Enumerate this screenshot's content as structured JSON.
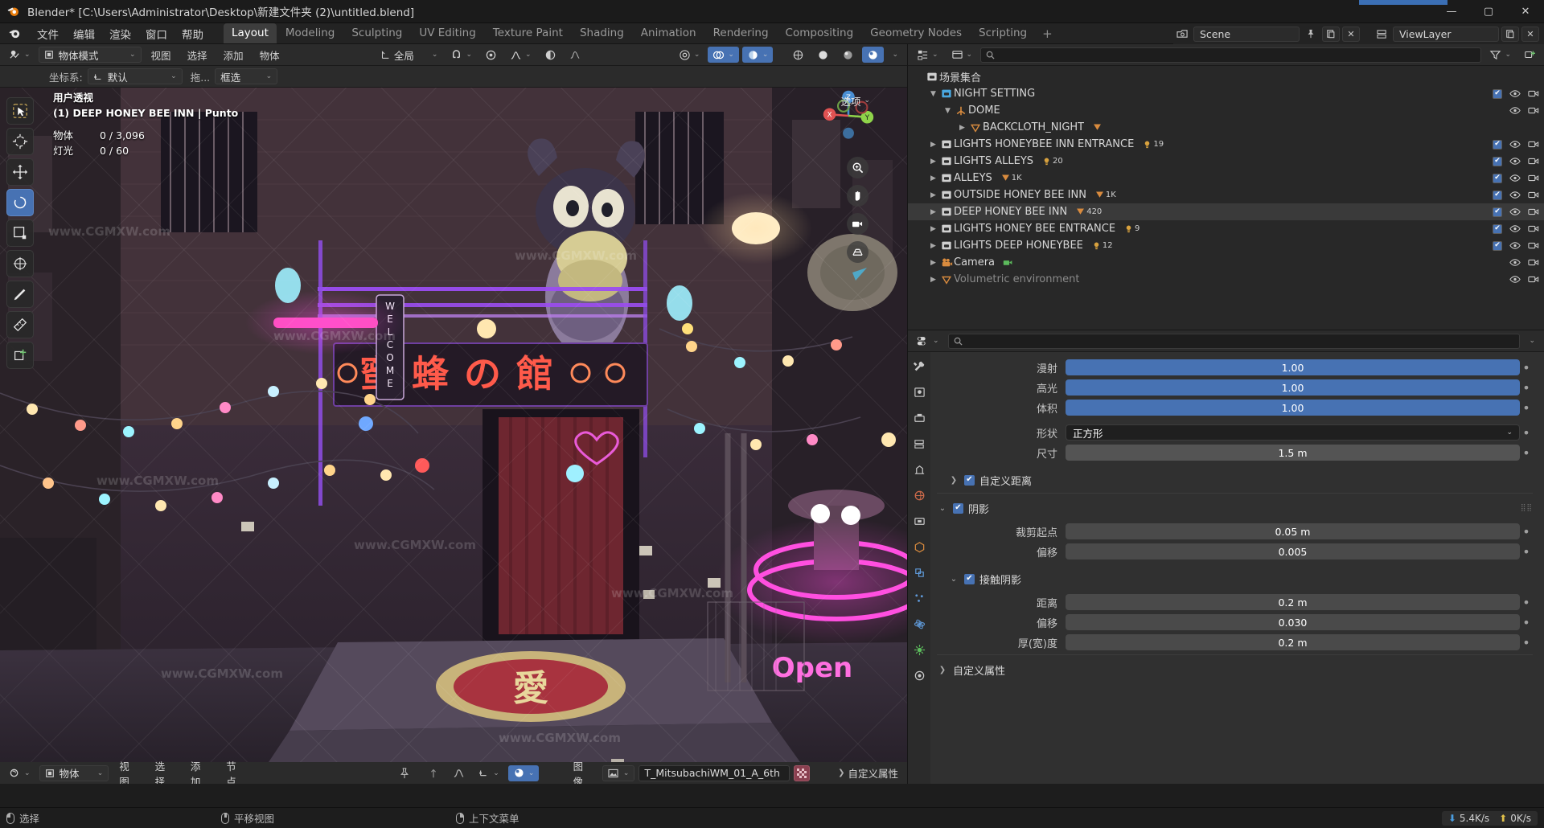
{
  "titlebar": {
    "title": "Blender* [C:\\Users\\Administrator\\Desktop\\新建文件夹 (2)\\untitled.blend]",
    "minimize": "—",
    "maximize": "▢",
    "close": "✕"
  },
  "menubar": {
    "items": [
      "文件",
      "编辑",
      "渲染",
      "窗口",
      "帮助"
    ],
    "workspaces": [
      {
        "label": "Layout",
        "active": true
      },
      {
        "label": "Modeling",
        "active": false
      },
      {
        "label": "Sculpting",
        "active": false
      },
      {
        "label": "UV Editing",
        "active": false
      },
      {
        "label": "Texture Paint",
        "active": false
      },
      {
        "label": "Shading",
        "active": false
      },
      {
        "label": "Animation",
        "active": false
      },
      {
        "label": "Rendering",
        "active": false
      },
      {
        "label": "Compositing",
        "active": false
      },
      {
        "label": "Geometry Nodes",
        "active": false
      },
      {
        "label": "Scripting",
        "active": false
      }
    ],
    "add_workspace": "+",
    "scene_name": "Scene",
    "viewlayer_name": "ViewLayer"
  },
  "viewport": {
    "mode": "物体模式",
    "menus": [
      "视图",
      "选择",
      "添加",
      "物体"
    ],
    "transform_orientation": "全局",
    "options_label": "选项",
    "row2": {
      "orient_label": "坐标系:",
      "orient_value": "默认",
      "drag_label": "拖...",
      "drag_value": "框选"
    },
    "overlay": {
      "perspective": "用户透视",
      "active_object": "(1) DEEP HONEY BEE INN | Punto",
      "stats": [
        {
          "key": "物体",
          "value": "0 / 3,096"
        },
        {
          "key": "灯光",
          "value": "0 / 60"
        }
      ]
    },
    "gizmo_axes": [
      "X",
      "Y",
      "Z"
    ],
    "footer": {
      "editor_mode": "物体",
      "menus": [
        "视图",
        "选择",
        "添加",
        "节点"
      ],
      "image_label": "图像",
      "image_name": "T_MitsubachiWM_01_A_6th",
      "custom_props": "自定义属性"
    }
  },
  "outliner": {
    "search_placeholder": "",
    "filter_icon": "funnel-icon",
    "rows": [
      {
        "name": "场景集合",
        "indent": 0,
        "tri": "",
        "icon": "collection-icon",
        "badge": null,
        "cnt": null,
        "check": false,
        "eye": false,
        "cam": false,
        "selected": false,
        "dim": false
      },
      {
        "name": "NIGHT SETTING",
        "indent": 1,
        "tri": "▼",
        "icon": "collection-blue-icon",
        "badge": null,
        "cnt": null,
        "check": true,
        "eye": true,
        "cam": true,
        "selected": false,
        "dim": false
      },
      {
        "name": "DOME",
        "indent": 2,
        "tri": "▼",
        "icon": "empty-axes-icon",
        "badge": null,
        "cnt": null,
        "check": false,
        "eye": true,
        "cam": true,
        "selected": false,
        "dim": false
      },
      {
        "name": "BACKCLOTH_NIGHT",
        "indent": 3,
        "tri": "▶",
        "icon": "mesh-cone-icon",
        "badge": "mesh-data-icon",
        "cnt": null,
        "check": false,
        "eye": false,
        "cam": false,
        "selected": false,
        "dim": false
      },
      {
        "name": "LIGHTS HONEYBEE INN ENTRANCE",
        "indent": 1,
        "tri": "▶",
        "icon": "collection-icon",
        "badge": "light-icon",
        "cnt": "19",
        "check": true,
        "eye": true,
        "cam": true,
        "selected": false,
        "dim": false
      },
      {
        "name": "LIGHTS ALLEYS",
        "indent": 1,
        "tri": "▶",
        "icon": "collection-icon",
        "badge": "light-icon",
        "cnt": "20",
        "check": true,
        "eye": true,
        "cam": true,
        "selected": false,
        "dim": false
      },
      {
        "name": "ALLEYS",
        "indent": 1,
        "tri": "▶",
        "icon": "collection-icon",
        "badge": "mesh-data-icon",
        "cnt": "1K",
        "check": true,
        "eye": true,
        "cam": true,
        "selected": false,
        "dim": false
      },
      {
        "name": "OUTSIDE HONEY BEE INN",
        "indent": 1,
        "tri": "▶",
        "icon": "collection-icon",
        "badge": "mesh-data-icon",
        "cnt": "1K",
        "check": true,
        "eye": true,
        "cam": true,
        "selected": false,
        "dim": false
      },
      {
        "name": "DEEP HONEY BEE INN",
        "indent": 1,
        "tri": "▶",
        "icon": "collection-icon",
        "badge": "mesh-data-icon",
        "cnt": "420",
        "check": true,
        "eye": true,
        "cam": true,
        "selected": true,
        "dim": false
      },
      {
        "name": "LIGHTS HONEY BEE ENTRANCE",
        "indent": 1,
        "tri": "▶",
        "icon": "collection-icon",
        "badge": "light-icon",
        "cnt": "9",
        "check": true,
        "eye": true,
        "cam": true,
        "selected": false,
        "dim": false
      },
      {
        "name": "LIGHTS DEEP HONEYBEE",
        "indent": 1,
        "tri": "▶",
        "icon": "collection-icon",
        "badge": "light-icon",
        "cnt": "12",
        "check": true,
        "eye": true,
        "cam": true,
        "selected": false,
        "dim": false
      },
      {
        "name": "Camera",
        "indent": 1,
        "tri": "▶",
        "icon": "camera-icon",
        "badge": "camera-data-icon",
        "cnt": null,
        "check": false,
        "eye": true,
        "cam": true,
        "selected": false,
        "dim": false
      },
      {
        "name": "Volumetric environment",
        "indent": 1,
        "tri": "▶",
        "icon": "mesh-cone-icon",
        "badge": null,
        "cnt": null,
        "check": false,
        "eye": true,
        "cam": true,
        "selected": false,
        "dim": true
      }
    ]
  },
  "properties": {
    "search_placeholder": "",
    "tabs": [
      "tool-icon",
      "render-icon",
      "output-icon",
      "viewlayer-icon",
      "scene-icon",
      "world-icon",
      "collection-icon",
      "object-icon",
      "modifier-icon",
      "particles-icon",
      "physics-icon",
      "constraint-icon",
      "data-icon",
      "material-icon"
    ],
    "fields": [
      {
        "label": "漫射",
        "value": "1.00",
        "kind": "slider"
      },
      {
        "label": "高光",
        "value": "1.00",
        "kind": "slider"
      },
      {
        "label": "体积",
        "value": "1.00",
        "kind": "slider"
      },
      {
        "label": "形状",
        "value": "正方形",
        "kind": "select"
      },
      {
        "label": "尺寸",
        "value": "1.5 m",
        "kind": "num"
      }
    ],
    "custom_distance": "自定义距离",
    "shadow_section": "阴影",
    "shadow_fields": [
      {
        "label": "裁剪起点",
        "value": "0.05 m"
      },
      {
        "label": "偏移",
        "value": "0.005"
      }
    ],
    "contact_shadow_section": "接触阴影",
    "contact_fields": [
      {
        "label": "距离",
        "value": "0.2 m"
      },
      {
        "label": "偏移",
        "value": "0.030"
      },
      {
        "label": "厚(宽)度",
        "value": "0.2 m"
      }
    ],
    "custom_props_section": "自定义属性"
  },
  "statusbar": {
    "items": [
      {
        "icon": "mouse-left-icon",
        "label": "选择"
      },
      {
        "icon": "mouse-middle-icon",
        "label": "平移视图"
      },
      {
        "icon": "mouse-right-icon",
        "label": "上下文菜单"
      }
    ],
    "download_speed": "5.4K/s",
    "upload_speed": "0K/s"
  },
  "colors": {
    "accent_blue": "#4772b3",
    "panel_bg": "#303030",
    "header_bg": "#2b2b2b",
    "outliner_bg": "#282828",
    "axis_x": "#e05252",
    "axis_y": "#8fd44a",
    "axis_z": "#4a8fd4"
  }
}
